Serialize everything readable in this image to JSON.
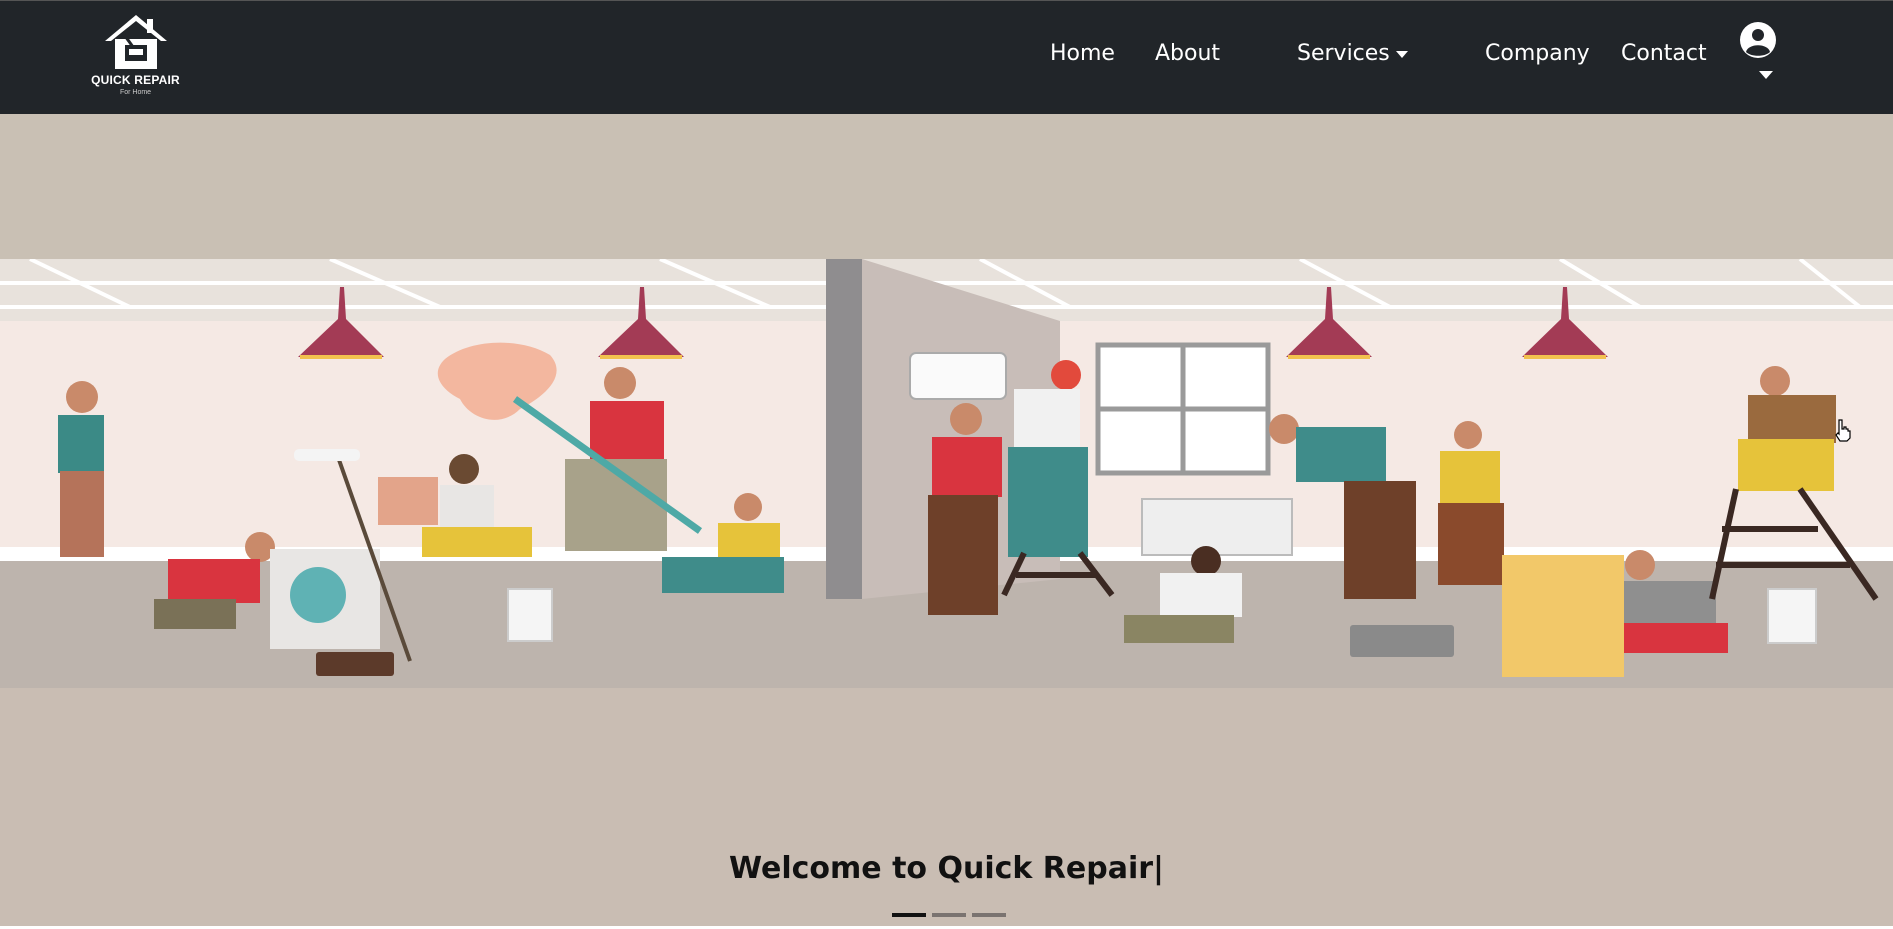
{
  "brand": {
    "title": "QUICK REPAIR",
    "subtitle": "For Home"
  },
  "nav": {
    "home": "Home",
    "about": "About",
    "services": "Services",
    "company": "Company",
    "contact": "Contact"
  },
  "icons": {
    "user": "user-circle-icon",
    "dropdown": "caret-down-icon",
    "logo": "house-tools-icon"
  },
  "hero": {
    "welcome": "Welcome to Quick Repair|",
    "slides": 3,
    "active_slide": 0
  },
  "colors": {
    "navbar": "#212529",
    "hero_bg": "#c9bdb3",
    "accent_red": "#d9343f"
  }
}
